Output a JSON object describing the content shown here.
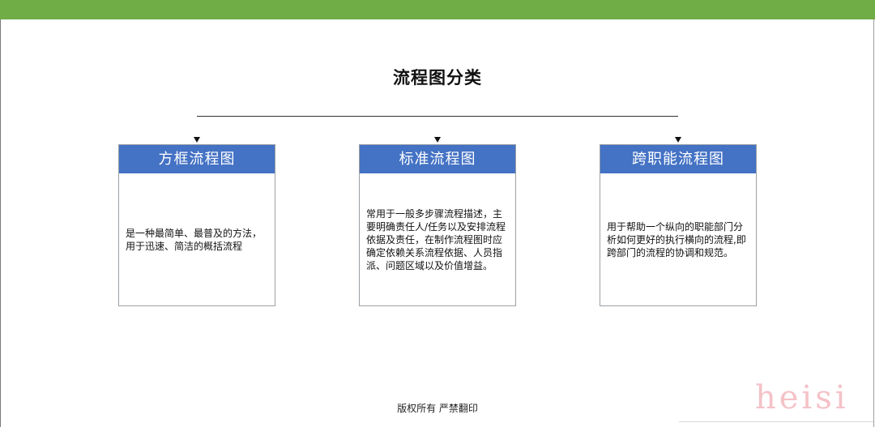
{
  "diagram": {
    "title": "流程图分类",
    "cards": [
      {
        "heading": "方框流程图",
        "text": "是一种最简单、最普及的方法，用于迅速、简洁的概括流程"
      },
      {
        "heading": "标准流程图",
        "text": "常用于一般多步骤流程描述，主要明确责任人/任务以及安排流程依据及责任，在制作流程图时应确定依赖关系流程依据、人员指派、问题区域以及价值增益。"
      },
      {
        "heading": "跨职能流程图",
        "text": "用于帮助一个纵向的职能部门分析如何更好的执行横向的流程,即跨部门的流程的协调和规范。"
      }
    ]
  },
  "footer": {
    "text": "版权所有 严禁翻印"
  },
  "watermark": {
    "text": "heisi"
  },
  "colors": {
    "top_bar": "#70ad47",
    "card_header": "#4472c4"
  }
}
